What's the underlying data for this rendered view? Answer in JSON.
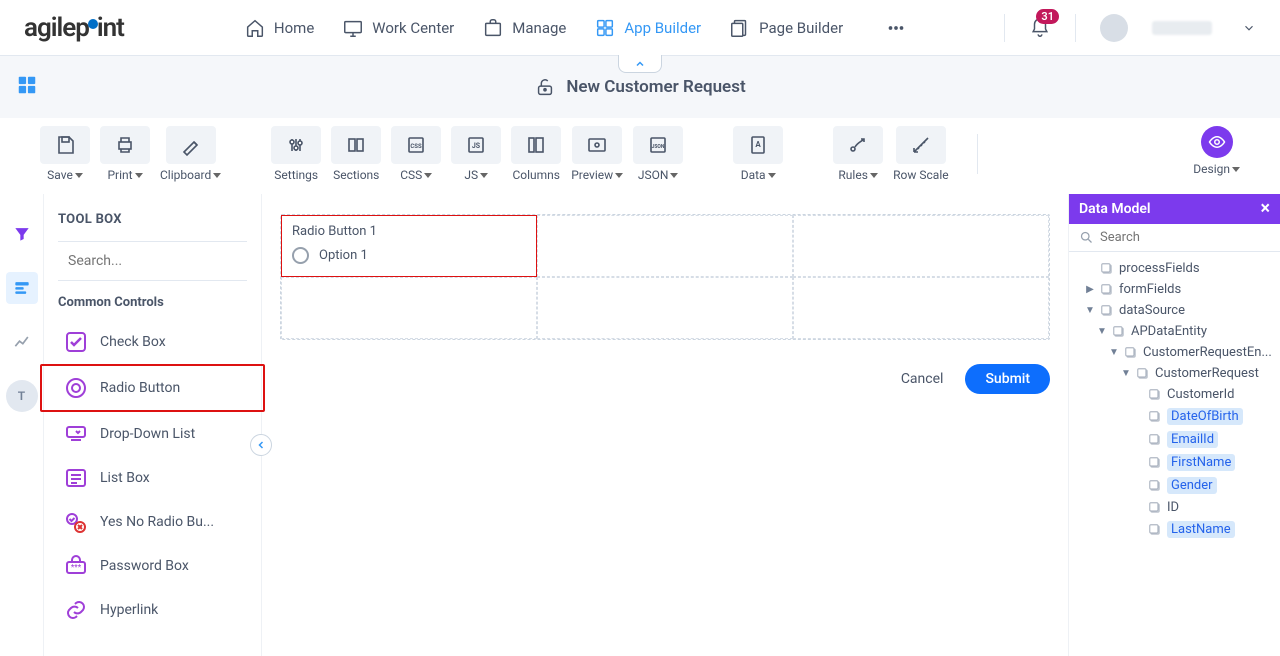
{
  "topnav": {
    "logo_a": "agilep",
    "logo_b": "int",
    "items": [
      {
        "label": "Home"
      },
      {
        "label": "Work Center"
      },
      {
        "label": "Manage"
      },
      {
        "label": "App Builder",
        "active": true
      },
      {
        "label": "Page Builder"
      }
    ],
    "notif_count": "31"
  },
  "page_title": "New Customer Request",
  "ribbon": [
    {
      "label": "Save",
      "dd": true
    },
    {
      "label": "Print",
      "dd": true
    },
    {
      "label": "Clipboard",
      "dd": true
    },
    {
      "gap": true
    },
    {
      "label": "Settings"
    },
    {
      "label": "Sections"
    },
    {
      "label": "CSS",
      "dd": true
    },
    {
      "label": "JS",
      "dd": true
    },
    {
      "label": "Columns"
    },
    {
      "label": "Preview",
      "dd": true
    },
    {
      "label": "JSON",
      "dd": true
    },
    {
      "gap": true
    },
    {
      "label": "Data",
      "dd": true
    },
    {
      "gap": true
    },
    {
      "label": "Rules",
      "dd": true
    },
    {
      "label": "Row Scale"
    }
  ],
  "design_label": "Design",
  "toolbox": {
    "title": "TOOL BOX",
    "search_placeholder": "Search...",
    "group": "Common Controls",
    "items": [
      {
        "label": "Check Box",
        "icon": "checkbox"
      },
      {
        "label": "Radio Button",
        "icon": "radio",
        "selected": true
      },
      {
        "label": "Drop-Down List",
        "icon": "dropdown"
      },
      {
        "label": "List Box",
        "icon": "listbox"
      },
      {
        "label": "Yes No Radio Bu...",
        "icon": "yesno"
      },
      {
        "label": "Password Box",
        "icon": "password"
      },
      {
        "label": "Hyperlink",
        "icon": "link"
      }
    ]
  },
  "canvas": {
    "field_label": "Radio Button 1",
    "option_label": "Option 1",
    "cancel": "Cancel",
    "submit": "Submit"
  },
  "datamodel": {
    "title": "Data Model",
    "search_placeholder": "Search",
    "rows": [
      {
        "ind": 1,
        "arrow": "",
        "label": "processFields"
      },
      {
        "ind": 1,
        "arrow": "▶",
        "label": "formFields"
      },
      {
        "ind": 1,
        "arrow": "▼",
        "label": "dataSource"
      },
      {
        "ind": 2,
        "arrow": "▼",
        "label": "APDataEntity"
      },
      {
        "ind": 3,
        "arrow": "▼",
        "label": "CustomerRequestEn..."
      },
      {
        "ind": 4,
        "arrow": "▼",
        "label": "CustomerRequest"
      },
      {
        "ind": 5,
        "arrow": "",
        "label": "CustomerId"
      },
      {
        "ind": 5,
        "arrow": "",
        "label": "DateOfBirth",
        "hl": true
      },
      {
        "ind": 5,
        "arrow": "",
        "label": "EmailId",
        "hl": true
      },
      {
        "ind": 5,
        "arrow": "",
        "label": "FirstName",
        "hl": true
      },
      {
        "ind": 5,
        "arrow": "",
        "label": "Gender",
        "hl": true
      },
      {
        "ind": 5,
        "arrow": "",
        "label": "ID"
      },
      {
        "ind": 5,
        "arrow": "",
        "label": "LastName",
        "hl": true
      }
    ]
  }
}
